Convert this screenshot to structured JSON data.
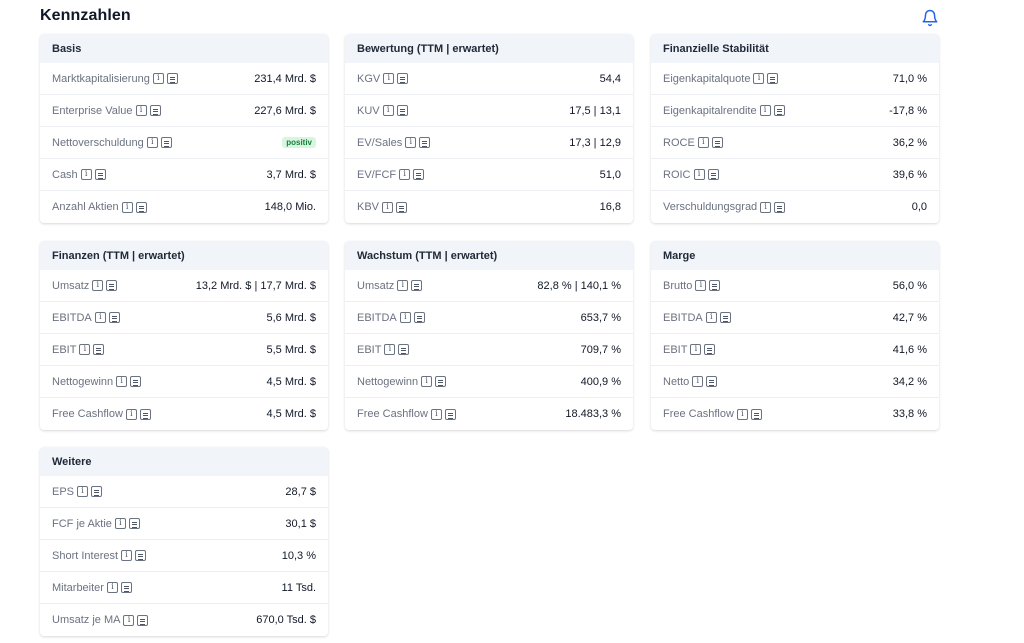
{
  "header": {
    "title": "Kennzahlen",
    "bell_icon": "bell-icon"
  },
  "colors": {
    "accent": "#2563eb",
    "badge_bg": "#d8f5e0",
    "badge_text": "#15803d"
  },
  "cards": {
    "basis": {
      "title": "Basis",
      "rows": [
        {
          "label": "Marktkapitalisierung",
          "value": "231,4 Mrd. $"
        },
        {
          "label": "Enterprise Value",
          "value": "227,6 Mrd. $"
        },
        {
          "label": "Nettoverschuldung",
          "value": "positiv"
        },
        {
          "label": "Cash",
          "value": "3,7 Mrd. $"
        },
        {
          "label": "Anzahl Aktien",
          "value": "148,0 Mio."
        }
      ]
    },
    "bewertung": {
      "title": "Bewertung (TTM | erwartet)",
      "rows": [
        {
          "label": "KGV",
          "value": "54,4"
        },
        {
          "label": "KUV",
          "value": "17,5 | 13,1"
        },
        {
          "label": "EV/Sales",
          "value": "17,3 | 12,9"
        },
        {
          "label": "EV/FCF",
          "value": "51,0"
        },
        {
          "label": "KBV",
          "value": "16,8"
        }
      ]
    },
    "stabilitaet": {
      "title": "Finanzielle Stabilität",
      "rows": [
        {
          "label": "Eigenkapitalquote",
          "value": "71,0 %"
        },
        {
          "label": "Eigenkapitalrendite",
          "value": "-17,8 %"
        },
        {
          "label": "ROCE",
          "value": "36,2 %"
        },
        {
          "label": "ROIC",
          "value": "39,6 %"
        },
        {
          "label": "Verschuldungsgrad",
          "value": "0,0"
        }
      ]
    },
    "finanzen": {
      "title": "Finanzen (TTM | erwartet)",
      "rows": [
        {
          "label": "Umsatz",
          "value": "13,2 Mrd. $ | 17,7 Mrd. $"
        },
        {
          "label": "EBITDA",
          "value": "5,6 Mrd. $"
        },
        {
          "label": "EBIT",
          "value": "5,5 Mrd. $"
        },
        {
          "label": "Nettogewinn",
          "value": "4,5 Mrd. $"
        },
        {
          "label": "Free Cashflow",
          "value": "4,5 Mrd. $"
        }
      ]
    },
    "wachstum": {
      "title": "Wachstum (TTM | erwartet)",
      "rows": [
        {
          "label": "Umsatz",
          "value": "82,8 % | 140,1 %"
        },
        {
          "label": "EBITDA",
          "value": "653,7 %"
        },
        {
          "label": "EBIT",
          "value": "709,7 %"
        },
        {
          "label": "Nettogewinn",
          "value": "400,9 %"
        },
        {
          "label": "Free Cashflow",
          "value": "18.483,3 %"
        }
      ]
    },
    "marge": {
      "title": "Marge",
      "rows": [
        {
          "label": "Brutto",
          "value": "56,0 %"
        },
        {
          "label": "EBITDA",
          "value": "42,7 %"
        },
        {
          "label": "EBIT",
          "value": "41,6 %"
        },
        {
          "label": "Netto",
          "value": "34,2 %"
        },
        {
          "label": "Free Cashflow",
          "value": "33,8 %"
        }
      ]
    },
    "weitere": {
      "title": "Weitere",
      "rows": [
        {
          "label": "EPS",
          "value": "28,7 $"
        },
        {
          "label": "FCF je Aktie",
          "value": "30,1 $"
        },
        {
          "label": "Short Interest",
          "value": "10,3 %"
        },
        {
          "label": "Mitarbeiter",
          "value": "11 Tsd."
        },
        {
          "label": "Umsatz je MA",
          "value": "670,0 Tsd. $"
        }
      ]
    }
  }
}
